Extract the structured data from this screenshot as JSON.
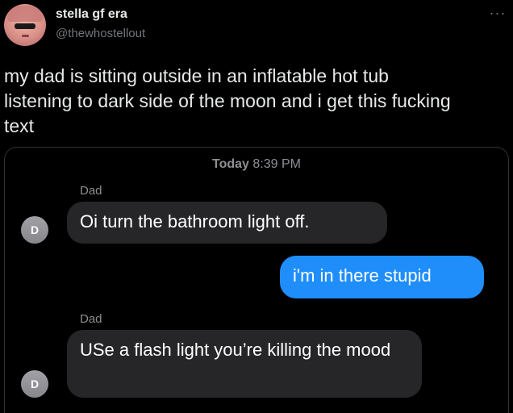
{
  "tweet": {
    "display_name": "stella gf era",
    "handle": "@thewhostellout",
    "more_label": "···",
    "text": "my dad is sitting outside in an inflatable hot tub\nlistening to dark side of the moon and i get this fucking\ntext"
  },
  "conversation": {
    "timestamp_day": "Today",
    "timestamp_time": "8:39 PM",
    "contact_initial": "D",
    "messages": [
      {
        "direction": "incoming",
        "sender": "Dad",
        "text": "Oi turn the bathroom light off."
      },
      {
        "direction": "outgoing",
        "sender": "",
        "text": "i'm in there stupid"
      },
      {
        "direction": "incoming",
        "sender": "Dad",
        "text": "USe a flash light you’re killing the mood"
      }
    ]
  },
  "colors": {
    "background": "#000000",
    "incoming_bubble": "#262628",
    "outgoing_bubble": "#1f8efb",
    "secondary_text": "#71767b"
  },
  "icons": {
    "more": "more-horizontal-icon"
  }
}
